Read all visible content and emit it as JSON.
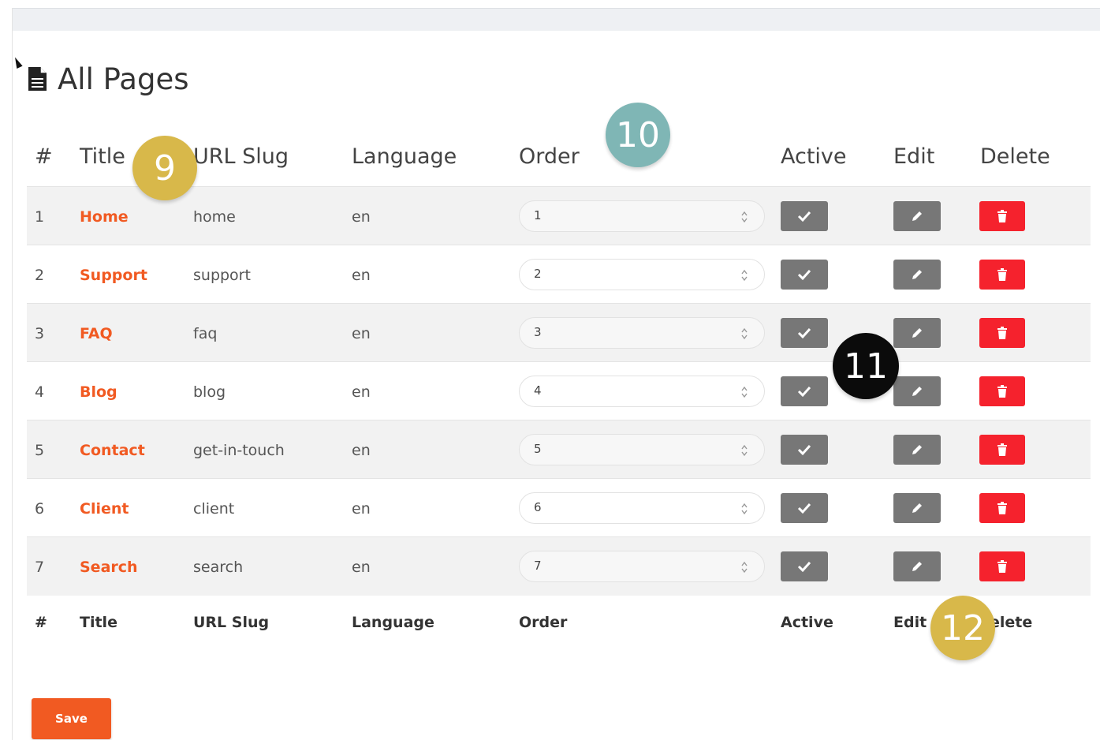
{
  "page": {
    "title": "All Pages",
    "icon": "document-icon"
  },
  "table": {
    "headers": {
      "num": "#",
      "title": "Title",
      "slug": "URL Slug",
      "language": "Language",
      "order": "Order",
      "active": "Active",
      "edit": "Edit",
      "delete": "Delete"
    },
    "footer": {
      "num": "#",
      "title": "Title",
      "slug": "URL Slug",
      "language": "Language",
      "order": "Order",
      "active": "Active",
      "edit": "Edit",
      "delete": "elete"
    },
    "rows": [
      {
        "num": "1",
        "title": "Home",
        "slug": "home",
        "language": "en",
        "order": "1"
      },
      {
        "num": "2",
        "title": "Support",
        "slug": "support",
        "language": "en",
        "order": "2"
      },
      {
        "num": "3",
        "title": "FAQ",
        "slug": "faq",
        "language": "en",
        "order": "3"
      },
      {
        "num": "4",
        "title": "Blog",
        "slug": "blog",
        "language": "en",
        "order": "4"
      },
      {
        "num": "5",
        "title": "Contact",
        "slug": "get-in-touch",
        "language": "en",
        "order": "5"
      },
      {
        "num": "6",
        "title": "Client",
        "slug": "client",
        "language": "en",
        "order": "6"
      },
      {
        "num": "7",
        "title": "Search",
        "slug": "search",
        "language": "en",
        "order": "7"
      }
    ]
  },
  "badges": {
    "b9": "9",
    "b10": "10",
    "b11": "11",
    "b12": "12"
  },
  "actions": {
    "save_label": "Save"
  },
  "colors": {
    "accent": "#f15a22",
    "delete": "#f5222d",
    "action_gray": "#777777",
    "badge_gold": "#d8b84a",
    "badge_teal": "#7fb6b5",
    "badge_black": "#0b0b0b"
  }
}
